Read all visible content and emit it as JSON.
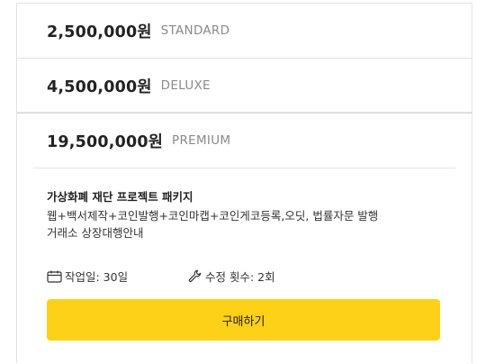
{
  "tiers": [
    {
      "price": "2,500,000원",
      "name": "STANDARD"
    },
    {
      "price": "4,500,000원",
      "name": "DELUXE"
    },
    {
      "price": "19,500,000원",
      "name": "PREMIUM"
    }
  ],
  "premium": {
    "title": "가상화폐 재단 프로젝트 패키지",
    "desc_lines": [
      "웹+백서제작+코인발행+코인마캡+코인게코등록,오딧, 법률자문 발행",
      "거래소 상장대행안내"
    ],
    "work_days_label": "작업일: 30일",
    "revisions_label": "수정 횟수: 2회",
    "buy_label": "구매하기"
  },
  "colors": {
    "accent": "#fcd117",
    "muted_text": "#8a8a8a",
    "border": "#e2e2e2"
  },
  "icons": {
    "work_days": "calendar-icon",
    "revisions": "wrench-icon"
  }
}
